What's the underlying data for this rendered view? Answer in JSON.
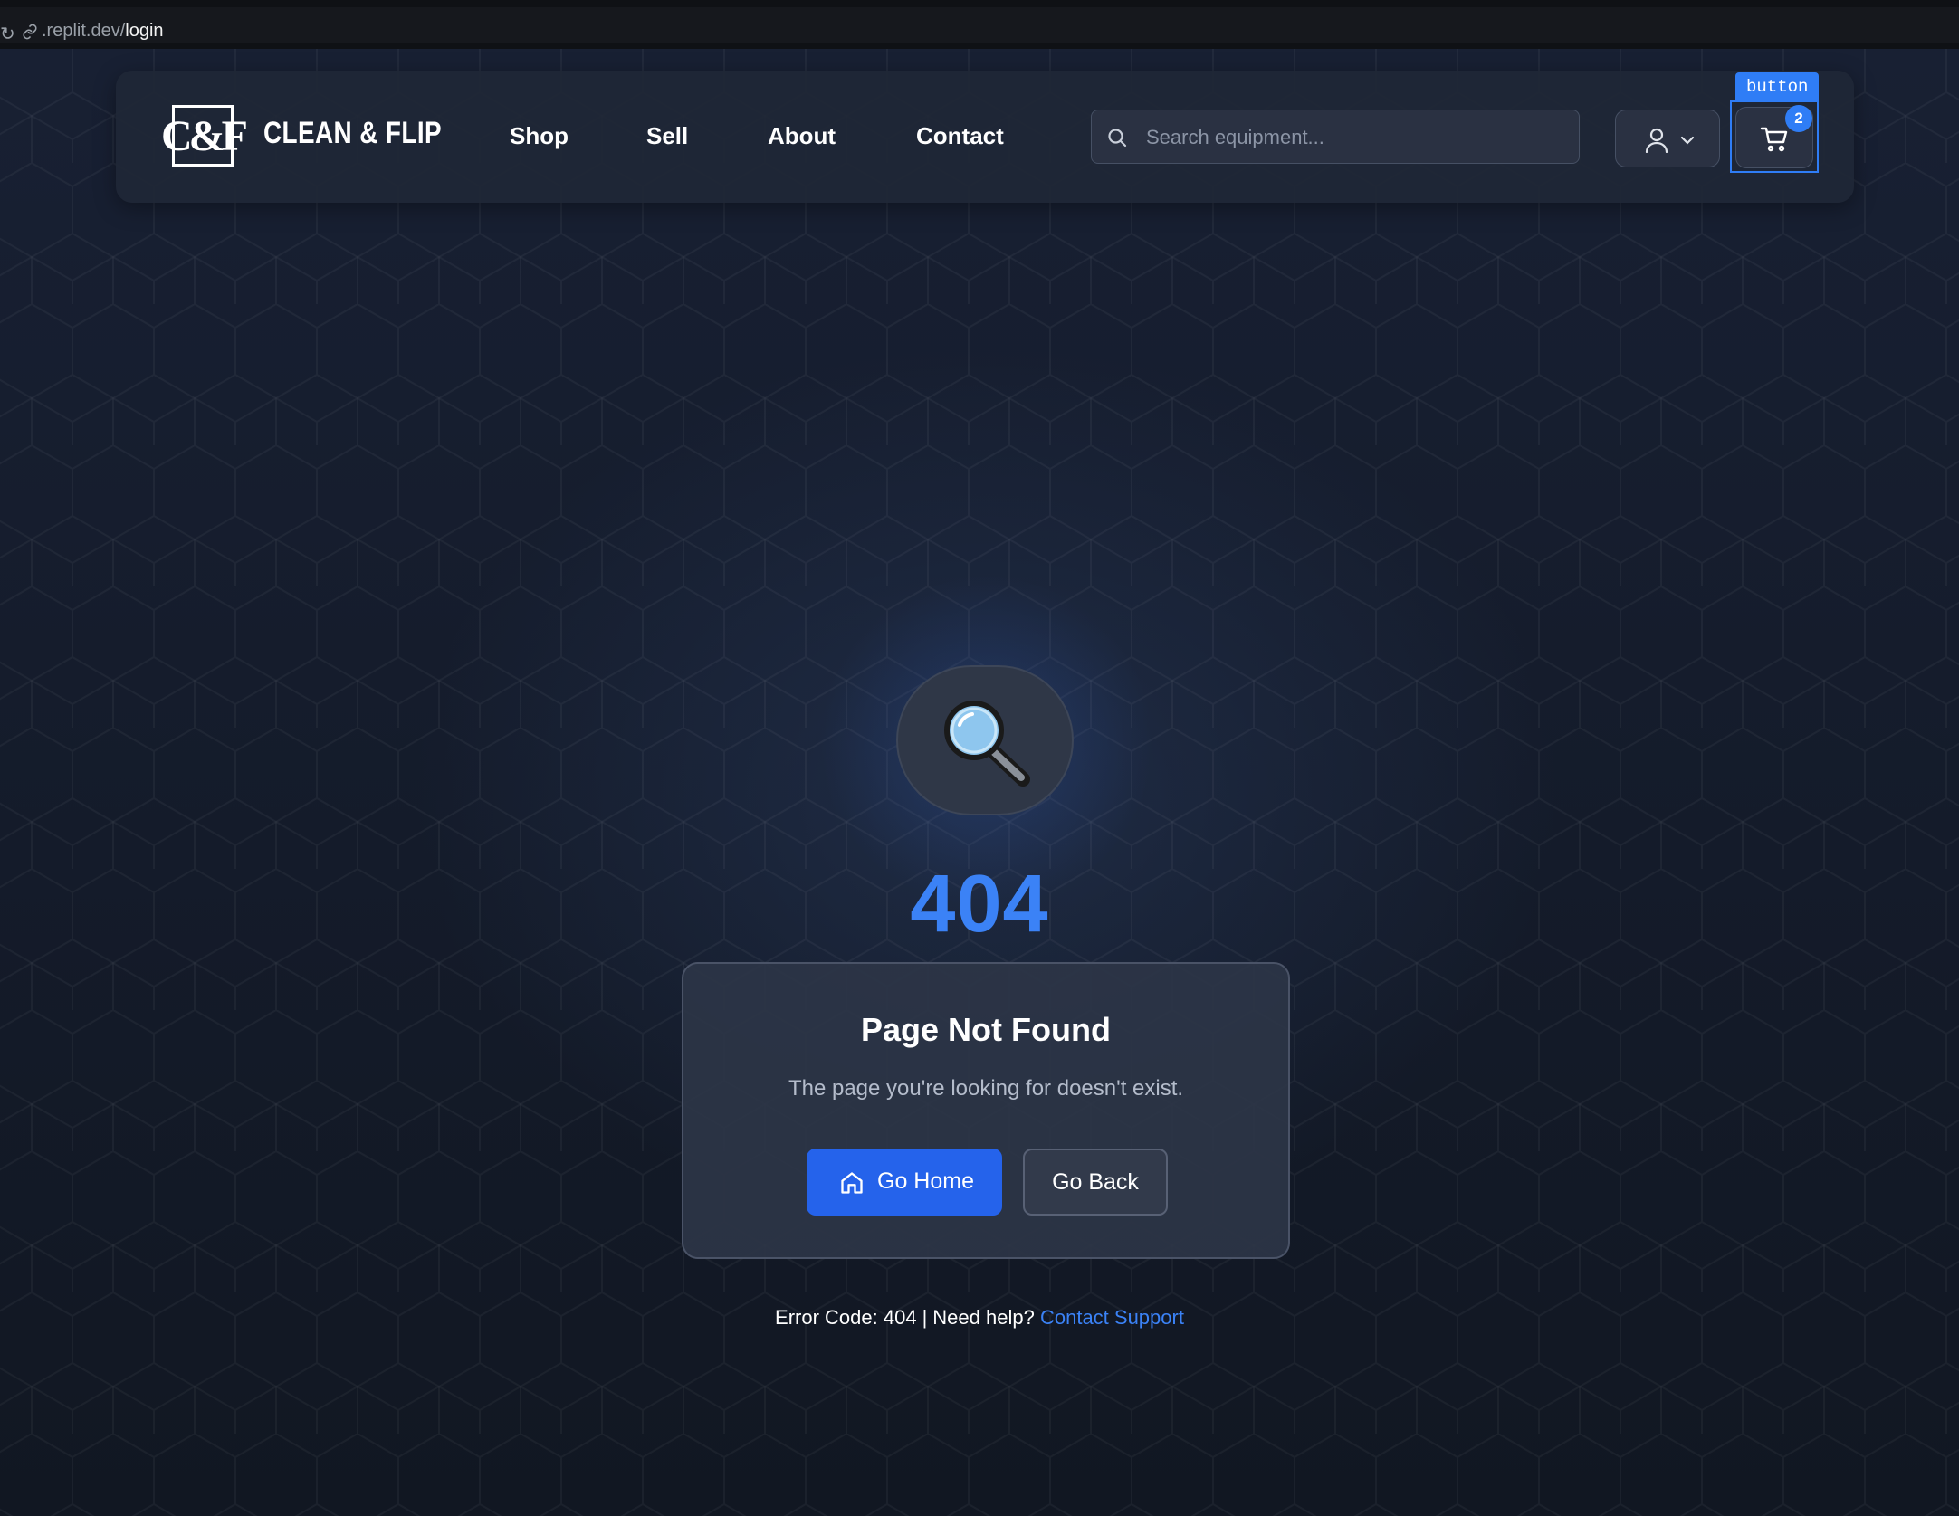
{
  "browser": {
    "url_prefix": ".replit.dev/",
    "url_path": "login"
  },
  "header": {
    "logo_text": "C&F",
    "brand": "CLEAN & FLIP",
    "nav": [
      {
        "label": "Shop"
      },
      {
        "label": "Sell"
      },
      {
        "label": "About"
      },
      {
        "label": "Contact"
      }
    ],
    "search_placeholder": "Search equipment...",
    "cart_count": "2",
    "inspector_tag": "button"
  },
  "main": {
    "error_code": "404",
    "title": "Page Not Found",
    "description": "The page you're looking for doesn't exist.",
    "home_button": "Go Home",
    "back_button": "Go Back"
  },
  "footer": {
    "error_text": "Error Code: 404",
    "separator": "|",
    "help_text": "Need help?",
    "support_link": "Contact Support"
  },
  "colors": {
    "accent": "#3b82f6",
    "primary_button": "#2563eb",
    "background": "#141a26"
  }
}
